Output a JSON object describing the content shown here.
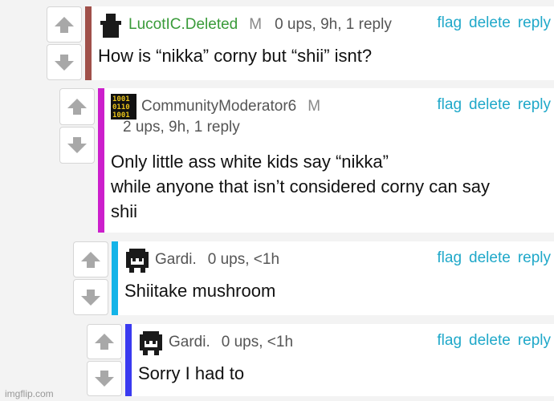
{
  "actions": {
    "flag": "flag",
    "delete": "delete",
    "reply": "reply"
  },
  "colors": {
    "bar_c1": "#a0504a",
    "bar_c2": "#cc1fcc",
    "bar_c3": "#14b4e8",
    "bar_c4": "#3a3af0",
    "link": "#1fa8c9"
  },
  "comments": [
    {
      "username": "LucotIC.Deleted",
      "badge": "M",
      "stats": "0 ups, 9h, 1 reply",
      "text": "How is “nikka” corny but “shii” isnt?",
      "avatar_icon": "silhouette-icon"
    },
    {
      "username": "CommunityModerator6",
      "badge": "M",
      "stats": "2 ups, 9h, 1 reply",
      "text_lines": [
        "Only little ass white kids say “nikka”",
        "while anyone that isn’t considered corny can say",
        "shii"
      ],
      "avatar_icon": "binary-code-icon"
    },
    {
      "username": "Gardi.",
      "stats": "0 ups, <1h",
      "text": "Shiitake mushroom",
      "avatar_icon": "pixel-face-icon"
    },
    {
      "username": "Gardi.",
      "stats": "0 ups, <1h",
      "text": "Sorry I had to",
      "avatar_icon": "pixel-face-icon"
    }
  ],
  "watermark": "imgflip.com"
}
